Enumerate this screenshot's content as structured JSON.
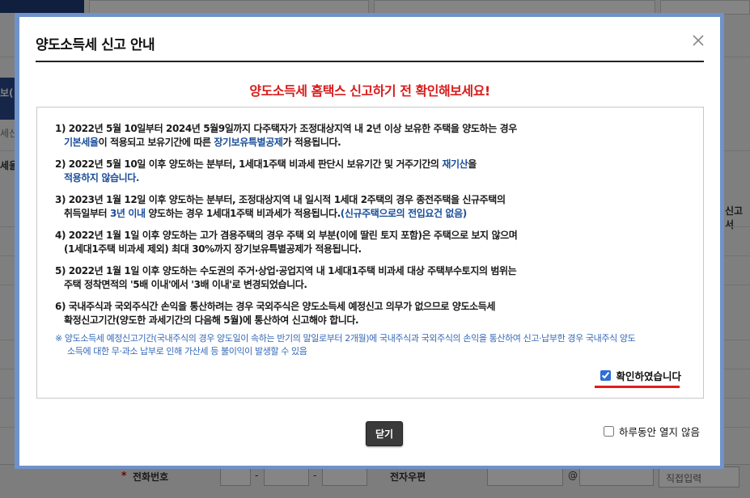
{
  "background": {
    "left_labels": [
      "보(",
      "세신",
      "세율"
    ],
    "right_label": "신고서",
    "phone_label": "전화번호",
    "zip_label": "전자우편",
    "at_sign": "@",
    "dash": "-",
    "star": "*",
    "email_select": "직접입력"
  },
  "modal": {
    "title": "양도소득세 신고 안내",
    "headline": "양도소득세 홈택스 신고하기 전 확인해보세요!",
    "items": [
      {
        "l1_pre": "1) 2022년 5월 10일부터 2024년 5월9일까지 다주택자가 조정대상지역 내 2년 이상 보유한 주택을 양도하는 경우",
        "l2_hl1": "기본세율",
        "l2_mid": "이 적용되고 보유기간에 따른 ",
        "l2_hl2": "장기보유특별공제",
        "l2_post": "가 적용됩니다."
      },
      {
        "l1_pre": "2) 2022년 5월 10일 이후 양도하는 분부터, 1세대1주택 비과세 판단시 보유기간 및 거주기간의 ",
        "l1_hl": "재기산",
        "l1_post": "을",
        "l2_hl": "적용하지 않습니다."
      },
      {
        "l1": "3) 2023년 1월 12일 이후 양도하는 분부터, 조정대상지역 내 일시적 1세대 2주택의 경우 종전주택을 신규주택의",
        "l2_pre": "취득일부터 ",
        "l2_hl1": "3년 이내",
        "l2_mid": " 양도하는 경우 1세대1주택 비과세가 적용됩니다.",
        "l2_hl2": "(신규주택으로의 전입요건 없음)"
      },
      {
        "l1": "4) 2022년 1월 1일 이후 양도하는 고가 겸용주택의 경우 주택 외 부분(이에 딸린 토지 포함)은 주택으로 보지 않으며",
        "l2": "(1세대1주택 비과세 제외) 최대 30%까지 장기보유특별공제가 적용됩니다."
      },
      {
        "l1": "5) 2022년 1월 1일 이후 양도하는 수도권의 주거·상업·공업지역 내 1세대1주택 비과세 대상 주택부수토지의 범위는",
        "l2": "주택 정착면적의 '5배 이내'에서 '3배 이내'로 변경되었습니다."
      },
      {
        "l1": "6) 국내주식과 국외주식간 손익을 통산하려는 경우 국외주식은 양도소득세 예정신고 의무가 없으므로 양도소득세",
        "l2": "확정신고기간(양도한 과세기간의 다음해 5월)에 통산하여 신고해야 합니다."
      }
    ],
    "note_l1": "※ 양도소득세 예정신고기간(국내주식의 경우 양도일이 속하는 반기의 말일로부터 2개월)에 국내주식과 국외주식의 손익을 통산하여 신고·납부한 경우 국내주식 양도",
    "note_l2": "소득에 대한 무·과소 납부로 인해 가산세 등 불이익이 발생할 수 있음",
    "confirm_label": "확인하였습니다",
    "close_button": "닫기",
    "no_show_label": "하루동안 열지 않음"
  },
  "colors": {
    "headline": "#d81b1b",
    "highlight": "#1a4e9a",
    "note": "#3468b8",
    "frame": "#6f92c9",
    "underline": "#e31b1b"
  }
}
